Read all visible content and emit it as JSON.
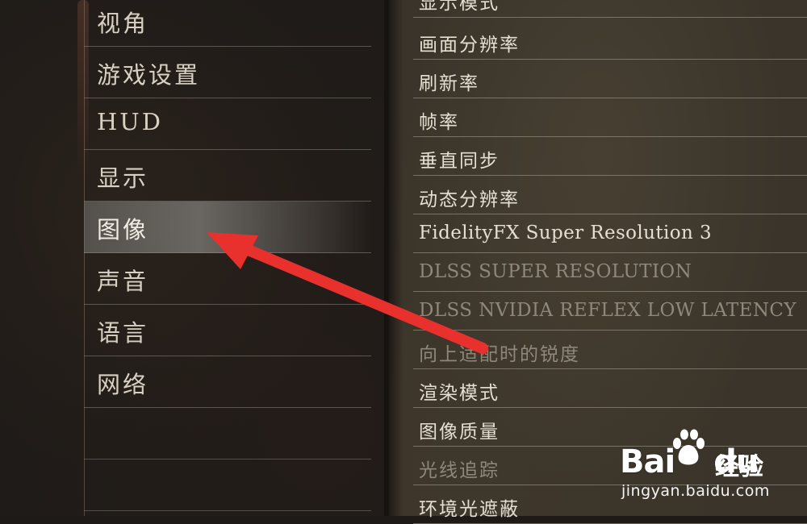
{
  "left_menu": {
    "items": [
      {
        "label": "视角",
        "selected": false
      },
      {
        "label": "游戏设置",
        "selected": false
      },
      {
        "label": "HUD",
        "selected": false
      },
      {
        "label": "显示",
        "selected": false
      },
      {
        "label": "图像",
        "selected": true
      },
      {
        "label": "声音",
        "selected": false
      },
      {
        "label": "语言",
        "selected": false
      },
      {
        "label": "网络",
        "selected": false
      }
    ]
  },
  "right_menu": {
    "items": [
      {
        "label": "显示模式",
        "enabled": true
      },
      {
        "label": "画面分辨率",
        "enabled": true
      },
      {
        "label": "刷新率",
        "enabled": true
      },
      {
        "label": "帧率",
        "enabled": true
      },
      {
        "label": "垂直同步",
        "enabled": true
      },
      {
        "label": "动态分辨率",
        "enabled": true
      },
      {
        "label": "FidelityFX Super Resolution 3",
        "enabled": true
      },
      {
        "label": "DLSS SUPER RESOLUTION",
        "enabled": false
      },
      {
        "label": "DLSS NVIDIA REFLEX LOW LATENCY",
        "enabled": false
      },
      {
        "label": "向上适配时的锐度",
        "enabled": false
      },
      {
        "label": "渲染模式",
        "enabled": true
      },
      {
        "label": "图像质量",
        "enabled": true
      },
      {
        "label": "光线追踪",
        "enabled": false
      },
      {
        "label": "环境光遮蔽",
        "enabled": true
      }
    ]
  },
  "annotation": {
    "arrow_color": "#e8302c"
  },
  "watermark": {
    "brand": "Bai",
    "brand_suffix": "du",
    "cn": "经验",
    "url": "jingyan.baidu.com",
    "icon": "baidu-paw-icon"
  },
  "colors": {
    "selected_highlight": "#9a9893",
    "text_enabled": "#e5dfd2",
    "text_disabled": "#8f887a"
  }
}
